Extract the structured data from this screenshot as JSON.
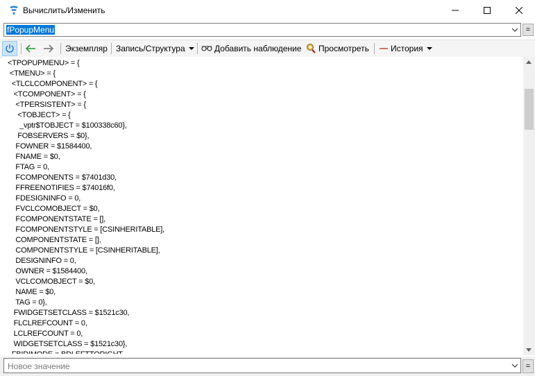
{
  "window": {
    "title": "Вычислить/Изменить"
  },
  "expression": {
    "value": "fPopupMenu"
  },
  "toolbar": {
    "instance_label": "Экземпляр",
    "record_label": "Запись/Структура",
    "add_watch_label": "Добавить наблюдение",
    "inspect_label": "Просмотреть",
    "history_label": "История"
  },
  "result_text": "<TPOPUPMENU> = {\n <TMENU> = {\n  <TLCLCOMPONENT> = {\n   <TCOMPONENT> = {\n    <TPERSISTENT> = {\n     <TOBJECT> = {\n      _vptr$TOBJECT = $100338c60},\n     FOBSERVERS = $0},\n    FOWNER = $1584400,\n    FNAME = $0,\n    FTAG = 0,\n    FCOMPONENTS = $7401d30,\n    FFREENOTIFIES = $74016f0,\n    FDESIGNINFO = 0,\n    FVCLCOMOBJECT = $0,\n    FCOMPONENTSTATE = [],\n    FCOMPONENTSTYLE = [CSINHERITABLE],\n    COMPONENTSTATE = [],\n    COMPONENTSTYLE = [CSINHERITABLE],\n    DESIGNINFO = 0,\n    OWNER = $1584400,\n    VCLCOMOBJECT = $0,\n    NAME = $0,\n    TAG = 0},\n   FWIDGETSETCLASS = $1521c30,\n   FLCLREFCOUNT = 0,\n   LCLREFCOUNT = 0,\n   WIDGETSETCLASS = $1521c30},\n  FBIDIMODE = BDLEFTTORIGHT,",
  "new_value": {
    "placeholder": "Новое значение"
  },
  "colors": {
    "selection": "#0078d7",
    "history_dash": "#c0392b",
    "arrow_back": "#2e9e3a"
  }
}
